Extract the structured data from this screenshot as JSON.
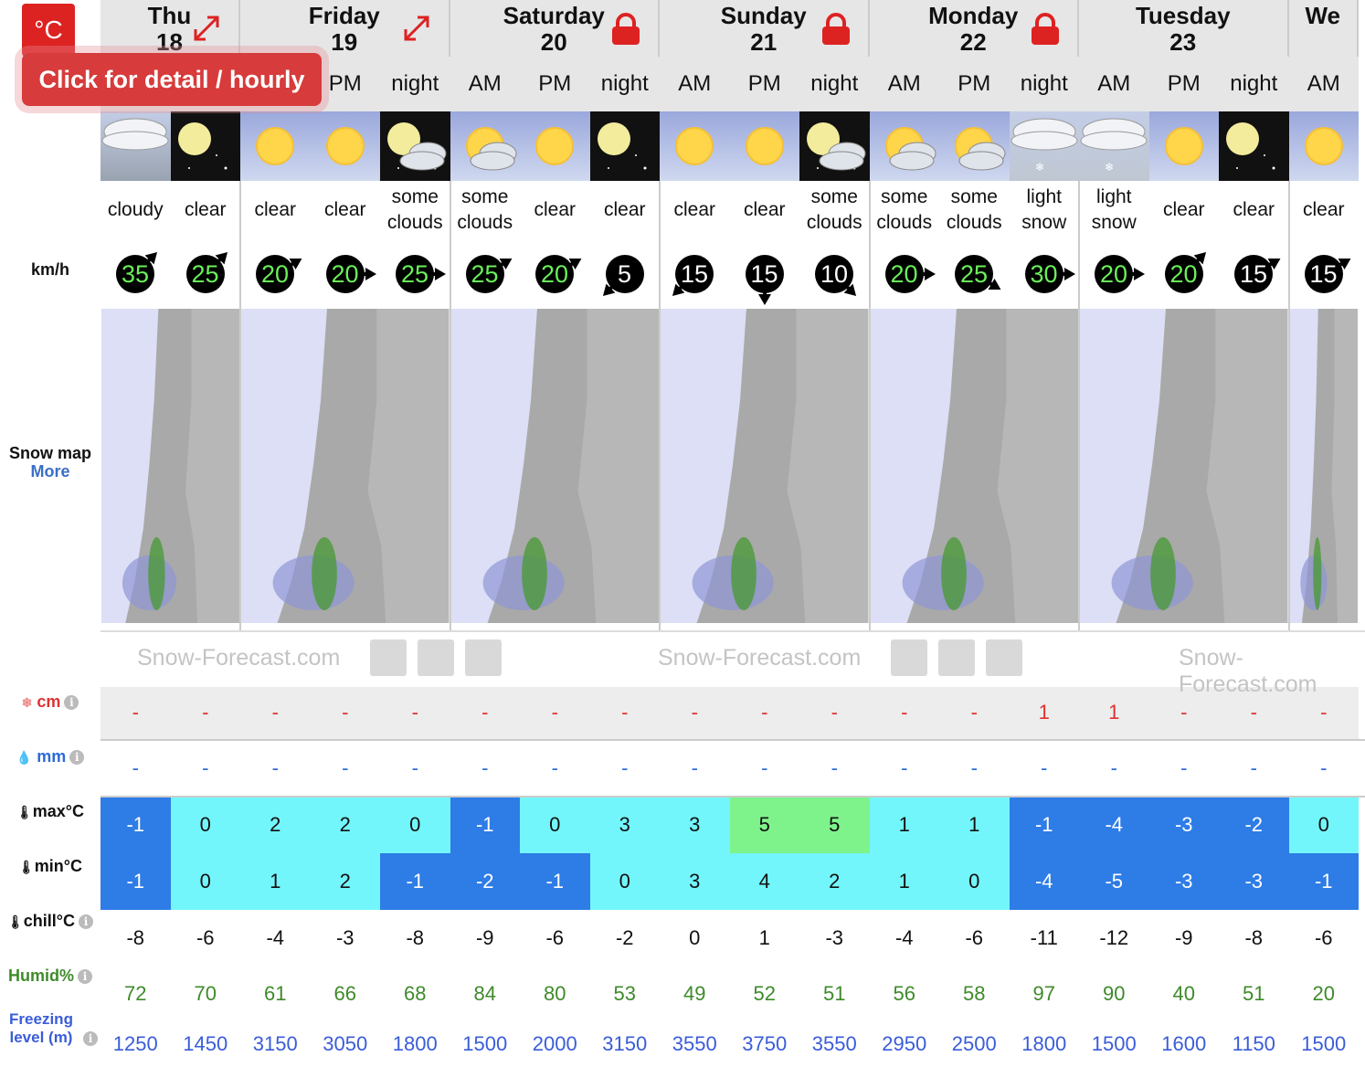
{
  "unit_button": "°C",
  "tooltip": "Click for detail / hourly",
  "row_labels": {
    "wind": "km/h",
    "snow_map": "Snow map",
    "snow_map_more": "More",
    "snow_cm": "cm",
    "rain_mm": "mm",
    "max_temp": "max°C",
    "min_temp": "min°C",
    "chill": "chill°C",
    "humid": "Humid%",
    "freezing": "Freezing level (m)"
  },
  "brand": "Snow-Forecast.com",
  "days": [
    {
      "name": "Thu",
      "num": "18",
      "icon": "expand-icon",
      "periods": 2
    },
    {
      "name": "Friday",
      "num": "19",
      "icon": "expand-icon",
      "periods": 3
    },
    {
      "name": "Saturday",
      "num": "20",
      "icon": "lock-icon",
      "periods": 3
    },
    {
      "name": "Sunday",
      "num": "21",
      "icon": "lock-icon",
      "periods": 3
    },
    {
      "name": "Monday",
      "num": "22",
      "icon": "lock-icon",
      "periods": 3
    },
    {
      "name": "Tuesday",
      "num": "23",
      "icon": "",
      "periods": 3
    },
    {
      "name": "We",
      "num": "",
      "icon": "",
      "periods": 1
    }
  ],
  "periods": [
    {
      "label": "",
      "weather": "cloudy",
      "icon": "cloud-day",
      "wind": "35",
      "wdir": 45,
      "snow": "-",
      "rain": "-",
      "max": "-1",
      "min": "-1",
      "chill": "-8",
      "humid": "72",
      "freeze": "1250"
    },
    {
      "label": "",
      "weather": "clear",
      "icon": "moon-night",
      "wind": "25",
      "wdir": 45,
      "snow": "-",
      "rain": "-",
      "max": "0",
      "min": "0",
      "chill": "-6",
      "humid": "70",
      "freeze": "1450"
    },
    {
      "label": "",
      "weather": "clear",
      "icon": "sun",
      "wind": "20",
      "wdir": 60,
      "snow": "-",
      "rain": "-",
      "max": "2",
      "min": "1",
      "chill": "-4",
      "humid": "61",
      "freeze": "3150"
    },
    {
      "label": "PM",
      "weather": "clear",
      "icon": "sun",
      "wind": "20",
      "wdir": 90,
      "snow": "-",
      "rain": "-",
      "max": "2",
      "min": "2",
      "chill": "-3",
      "humid": "66",
      "freeze": "3050"
    },
    {
      "label": "night",
      "weather": "some clouds",
      "icon": "moon-cloud",
      "wind": "25",
      "wdir": 90,
      "snow": "-",
      "rain": "-",
      "max": "0",
      "min": "-1",
      "chill": "-8",
      "humid": "68",
      "freeze": "1800"
    },
    {
      "label": "AM",
      "weather": "some clouds",
      "icon": "sun-cloud",
      "wind": "25",
      "wdir": 60,
      "snow": "-",
      "rain": "-",
      "max": "-1",
      "min": "-2",
      "chill": "-9",
      "humid": "84",
      "freeze": "1500"
    },
    {
      "label": "PM",
      "weather": "clear",
      "icon": "sun",
      "wind": "20",
      "wdir": 60,
      "snow": "-",
      "rain": "-",
      "max": "0",
      "min": "-1",
      "chill": "-6",
      "humid": "80",
      "freeze": "2000"
    },
    {
      "label": "night",
      "weather": "clear",
      "icon": "moon-night",
      "wind": "5",
      "wdir": 225,
      "snow": "-",
      "rain": "-",
      "max": "3",
      "min": "0",
      "chill": "-2",
      "humid": "53",
      "freeze": "3150"
    },
    {
      "label": "AM",
      "weather": "clear",
      "icon": "sun",
      "wind": "15",
      "wdir": 225,
      "snow": "-",
      "rain": "-",
      "max": "3",
      "min": "3",
      "chill": "0",
      "humid": "49",
      "freeze": "3550"
    },
    {
      "label": "PM",
      "weather": "clear",
      "icon": "sun",
      "wind": "15",
      "wdir": 180,
      "snow": "-",
      "rain": "-",
      "max": "5",
      "min": "4",
      "chill": "1",
      "humid": "52",
      "freeze": "3750"
    },
    {
      "label": "night",
      "weather": "some clouds",
      "icon": "moon-cloud",
      "wind": "10",
      "wdir": 135,
      "snow": "-",
      "rain": "-",
      "max": "5",
      "min": "2",
      "chill": "-3",
      "humid": "51",
      "freeze": "3550"
    },
    {
      "label": "AM",
      "weather": "some clouds",
      "icon": "sun-cloud",
      "wind": "20",
      "wdir": 90,
      "snow": "-",
      "rain": "-",
      "max": "1",
      "min": "1",
      "chill": "-4",
      "humid": "56",
      "freeze": "2950"
    },
    {
      "label": "PM",
      "weather": "some clouds",
      "icon": "sun-cloud",
      "wind": "25",
      "wdir": 120,
      "snow": "-",
      "rain": "-",
      "max": "1",
      "min": "0",
      "chill": "-6",
      "humid": "58",
      "freeze": "2500"
    },
    {
      "label": "night",
      "weather": "light snow",
      "icon": "snow-cloud",
      "wind": "30",
      "wdir": 90,
      "snow": "1",
      "rain": "-",
      "max": "-1",
      "min": "-4",
      "chill": "-11",
      "humid": "97",
      "freeze": "1800"
    },
    {
      "label": "AM",
      "weather": "light snow",
      "icon": "snow-cloud",
      "wind": "20",
      "wdir": 90,
      "snow": "1",
      "rain": "-",
      "max": "-4",
      "min": "-5",
      "chill": "-12",
      "humid": "90",
      "freeze": "1500"
    },
    {
      "label": "PM",
      "weather": "clear",
      "icon": "sun",
      "wind": "20",
      "wdir": 45,
      "snow": "-",
      "rain": "-",
      "max": "-3",
      "min": "-3",
      "chill": "-9",
      "humid": "40",
      "freeze": "1600"
    },
    {
      "label": "night",
      "weather": "clear",
      "icon": "moon-night",
      "wind": "15",
      "wdir": 60,
      "snow": "-",
      "rain": "-",
      "max": "-2",
      "min": "-3",
      "chill": "-8",
      "humid": "51",
      "freeze": "1150"
    },
    {
      "label": "AM",
      "weather": "clear",
      "icon": "sun",
      "wind": "15",
      "wdir": 60,
      "snow": "-",
      "rain": "-",
      "max": "0",
      "min": "-1",
      "chill": "-6",
      "humid": "20",
      "freeze": "1500"
    }
  ],
  "colors": {
    "temp_cold": "#2e7ce6",
    "temp_cool": "#73f6fb",
    "temp_mild": "#7ef38c",
    "wind_green": "#6af05a",
    "snow_text": "#e03030"
  }
}
